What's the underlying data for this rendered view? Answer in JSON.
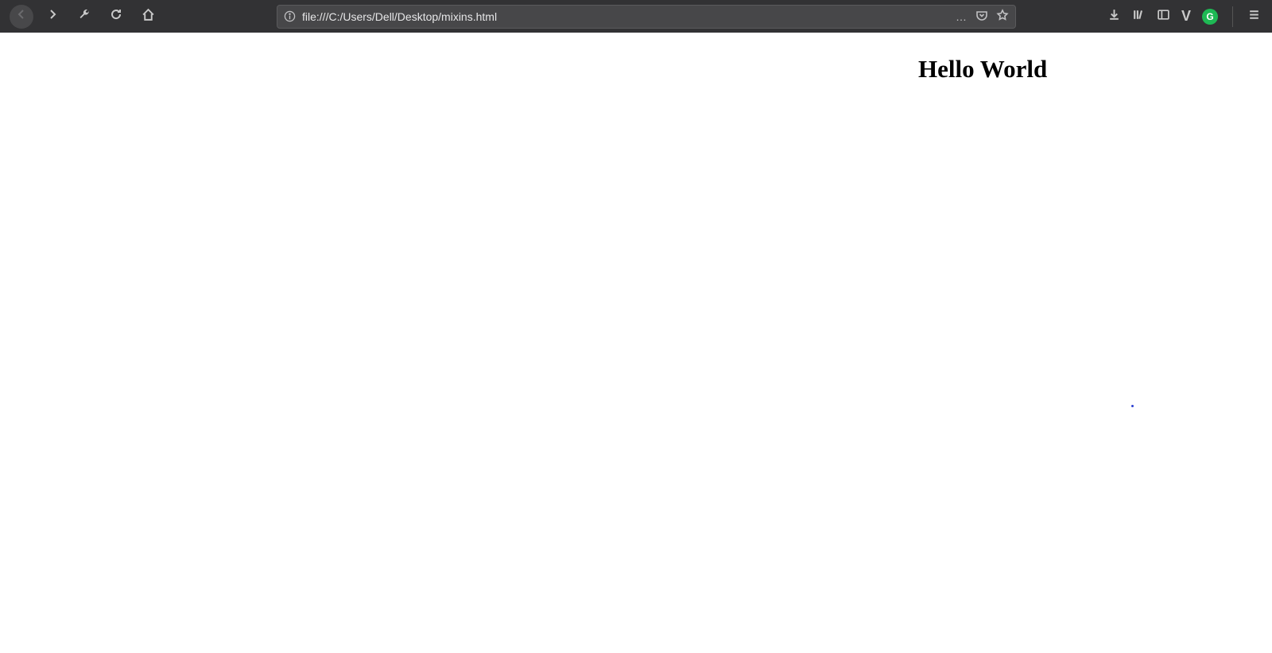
{
  "chrome": {
    "url": "file:///C:/Users/Dell/Desktop/mixins.html",
    "icons": {
      "back": "back-icon",
      "forward": "forward-icon",
      "tools": "wrench-icon",
      "reload": "reload-icon",
      "home": "home-icon",
      "info": "info-icon",
      "ellipsis": "…",
      "pocket": "pocket-icon",
      "star": "star-icon",
      "download": "download-icon",
      "library": "library-icon",
      "sidebar": "sidebar-icon",
      "vue_badge": "V",
      "grammarly_badge": "G",
      "menu": "menu-icon"
    }
  },
  "page": {
    "heading": "Hello World"
  },
  "colors": {
    "chrome_bg": "#323234",
    "address_bg": "#474749",
    "accent_green": "#1eb954"
  }
}
